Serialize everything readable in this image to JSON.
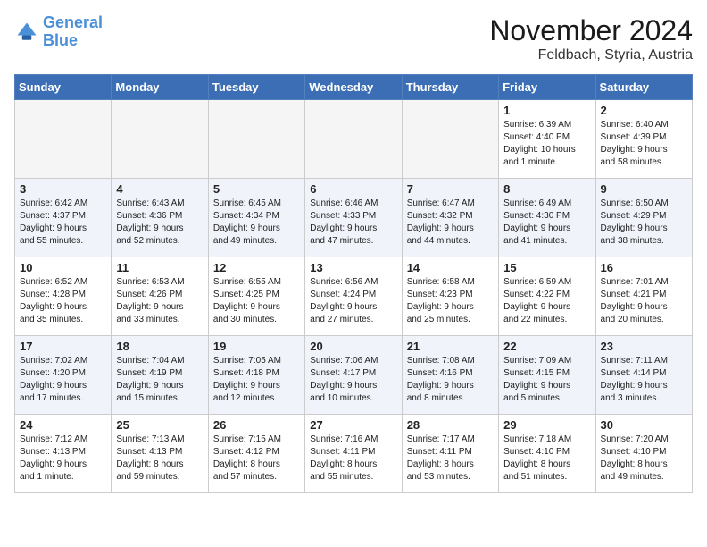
{
  "logo": {
    "line1": "General",
    "line2": "Blue"
  },
  "title": "November 2024",
  "location": "Feldbach, Styria, Austria",
  "weekdays": [
    "Sunday",
    "Monday",
    "Tuesday",
    "Wednesday",
    "Thursday",
    "Friday",
    "Saturday"
  ],
  "weeks": [
    [
      {
        "day": "",
        "info": ""
      },
      {
        "day": "",
        "info": ""
      },
      {
        "day": "",
        "info": ""
      },
      {
        "day": "",
        "info": ""
      },
      {
        "day": "",
        "info": ""
      },
      {
        "day": "1",
        "info": "Sunrise: 6:39 AM\nSunset: 4:40 PM\nDaylight: 10 hours\nand 1 minute."
      },
      {
        "day": "2",
        "info": "Sunrise: 6:40 AM\nSunset: 4:39 PM\nDaylight: 9 hours\nand 58 minutes."
      }
    ],
    [
      {
        "day": "3",
        "info": "Sunrise: 6:42 AM\nSunset: 4:37 PM\nDaylight: 9 hours\nand 55 minutes."
      },
      {
        "day": "4",
        "info": "Sunrise: 6:43 AM\nSunset: 4:36 PM\nDaylight: 9 hours\nand 52 minutes."
      },
      {
        "day": "5",
        "info": "Sunrise: 6:45 AM\nSunset: 4:34 PM\nDaylight: 9 hours\nand 49 minutes."
      },
      {
        "day": "6",
        "info": "Sunrise: 6:46 AM\nSunset: 4:33 PM\nDaylight: 9 hours\nand 47 minutes."
      },
      {
        "day": "7",
        "info": "Sunrise: 6:47 AM\nSunset: 4:32 PM\nDaylight: 9 hours\nand 44 minutes."
      },
      {
        "day": "8",
        "info": "Sunrise: 6:49 AM\nSunset: 4:30 PM\nDaylight: 9 hours\nand 41 minutes."
      },
      {
        "day": "9",
        "info": "Sunrise: 6:50 AM\nSunset: 4:29 PM\nDaylight: 9 hours\nand 38 minutes."
      }
    ],
    [
      {
        "day": "10",
        "info": "Sunrise: 6:52 AM\nSunset: 4:28 PM\nDaylight: 9 hours\nand 35 minutes."
      },
      {
        "day": "11",
        "info": "Sunrise: 6:53 AM\nSunset: 4:26 PM\nDaylight: 9 hours\nand 33 minutes."
      },
      {
        "day": "12",
        "info": "Sunrise: 6:55 AM\nSunset: 4:25 PM\nDaylight: 9 hours\nand 30 minutes."
      },
      {
        "day": "13",
        "info": "Sunrise: 6:56 AM\nSunset: 4:24 PM\nDaylight: 9 hours\nand 27 minutes."
      },
      {
        "day": "14",
        "info": "Sunrise: 6:58 AM\nSunset: 4:23 PM\nDaylight: 9 hours\nand 25 minutes."
      },
      {
        "day": "15",
        "info": "Sunrise: 6:59 AM\nSunset: 4:22 PM\nDaylight: 9 hours\nand 22 minutes."
      },
      {
        "day": "16",
        "info": "Sunrise: 7:01 AM\nSunset: 4:21 PM\nDaylight: 9 hours\nand 20 minutes."
      }
    ],
    [
      {
        "day": "17",
        "info": "Sunrise: 7:02 AM\nSunset: 4:20 PM\nDaylight: 9 hours\nand 17 minutes."
      },
      {
        "day": "18",
        "info": "Sunrise: 7:04 AM\nSunset: 4:19 PM\nDaylight: 9 hours\nand 15 minutes."
      },
      {
        "day": "19",
        "info": "Sunrise: 7:05 AM\nSunset: 4:18 PM\nDaylight: 9 hours\nand 12 minutes."
      },
      {
        "day": "20",
        "info": "Sunrise: 7:06 AM\nSunset: 4:17 PM\nDaylight: 9 hours\nand 10 minutes."
      },
      {
        "day": "21",
        "info": "Sunrise: 7:08 AM\nSunset: 4:16 PM\nDaylight: 9 hours\nand 8 minutes."
      },
      {
        "day": "22",
        "info": "Sunrise: 7:09 AM\nSunset: 4:15 PM\nDaylight: 9 hours\nand 5 minutes."
      },
      {
        "day": "23",
        "info": "Sunrise: 7:11 AM\nSunset: 4:14 PM\nDaylight: 9 hours\nand 3 minutes."
      }
    ],
    [
      {
        "day": "24",
        "info": "Sunrise: 7:12 AM\nSunset: 4:13 PM\nDaylight: 9 hours\nand 1 minute."
      },
      {
        "day": "25",
        "info": "Sunrise: 7:13 AM\nSunset: 4:13 PM\nDaylight: 8 hours\nand 59 minutes."
      },
      {
        "day": "26",
        "info": "Sunrise: 7:15 AM\nSunset: 4:12 PM\nDaylight: 8 hours\nand 57 minutes."
      },
      {
        "day": "27",
        "info": "Sunrise: 7:16 AM\nSunset: 4:11 PM\nDaylight: 8 hours\nand 55 minutes."
      },
      {
        "day": "28",
        "info": "Sunrise: 7:17 AM\nSunset: 4:11 PM\nDaylight: 8 hours\nand 53 minutes."
      },
      {
        "day": "29",
        "info": "Sunrise: 7:18 AM\nSunset: 4:10 PM\nDaylight: 8 hours\nand 51 minutes."
      },
      {
        "day": "30",
        "info": "Sunrise: 7:20 AM\nSunset: 4:10 PM\nDaylight: 8 hours\nand 49 minutes."
      }
    ]
  ]
}
